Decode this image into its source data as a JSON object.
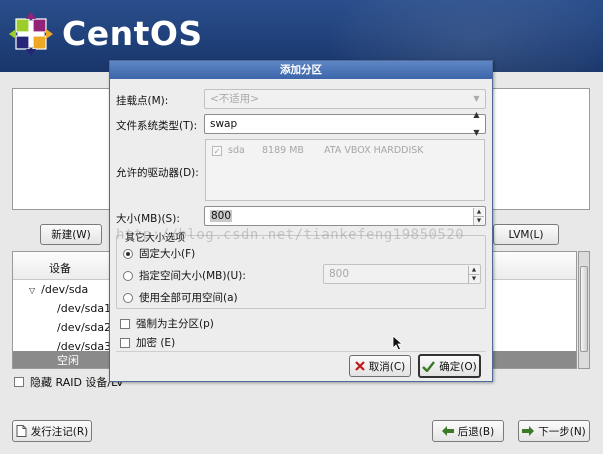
{
  "banner": {
    "logo_text": "CentOS"
  },
  "toolbar": {
    "new_label": "新建(W)",
    "lvm_label": "LVM(L)"
  },
  "tree": {
    "header_device": "设备",
    "rows": [
      "/dev/sda",
      "/dev/sda1",
      "/dev/sda2",
      "/dev/sda3",
      "空闲"
    ]
  },
  "hide_raid_label": "隐藏 RAID 设备/LV",
  "footer": {
    "release_notes_label": "发行注记(R)",
    "back_label": "后退(B)",
    "next_label": "下一步(N)"
  },
  "dialog": {
    "title": "添加分区",
    "mount_point_label": "挂载点(M):",
    "mount_point_value": "<不适用>",
    "fs_type_label": "文件系统类型(T):",
    "fs_type_value": "swap",
    "drives_label": "允许的驱动器(D):",
    "drive": {
      "name": "sda",
      "size": "8189 MB",
      "model": "ATA VBOX HARDDISK"
    },
    "size_label": "大小(MB)(S):",
    "size_value": "800",
    "other_size_options_label": "其它大小选项",
    "fixed_size_label": "固定大小(F)",
    "max_size_label": "指定空间大小(MB)(U):",
    "max_size_value": "800",
    "fill_all_label": "使用全部可用空间(a)",
    "force_primary_label": "强制为主分区(p)",
    "encrypt_label": "加密 (E)",
    "cancel_label": "取消(C)",
    "ok_label": "确定(O)"
  },
  "watermark": "http://blog.csdn.net/tiankefeng19850520",
  "colors": {
    "banner": "#1f3f78",
    "dialog_title": "#4a72b6",
    "selected_row": "#8a8a8a"
  },
  "icons": {
    "cancel": "x-icon",
    "ok": "checkmark-icon",
    "back": "arrow-left-icon",
    "next": "arrow-right-icon",
    "release_notes": "document-icon"
  }
}
